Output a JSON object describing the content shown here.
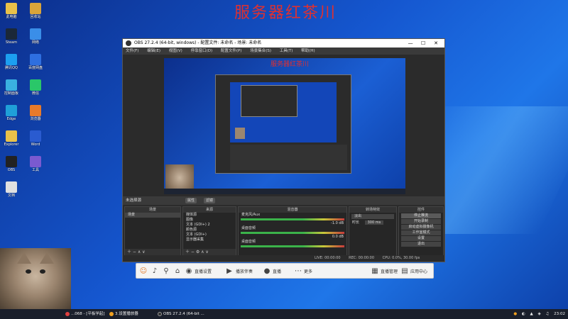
{
  "banner": "服务器红茶川",
  "desktop_icons": [
    {
      "label": "此电脑",
      "color": "#e8c14a"
    },
    {
      "label": "回收站",
      "color": "#d9a43a"
    },
    {
      "label": "Steam",
      "color": "#1b2838"
    },
    {
      "label": "网络",
      "color": "#3a8ee8"
    },
    {
      "label": "腾讯QQ",
      "color": "#1c9ff0"
    },
    {
      "label": "百度网盘",
      "color": "#2e6fe0"
    },
    {
      "label": "控制面板",
      "color": "#3ab0e0"
    },
    {
      "label": "微信",
      "color": "#2ac769"
    },
    {
      "label": "Edge",
      "color": "#1fa0d8"
    },
    {
      "label": "浏览器",
      "color": "#e87a2a"
    },
    {
      "label": "Explorer",
      "color": "#e8c14a"
    },
    {
      "label": "Word",
      "color": "#2a5bd0"
    },
    {
      "label": "OBS",
      "color": "#222222"
    },
    {
      "label": "工具",
      "color": "#7a5ad0"
    },
    {
      "label": "文档",
      "color": "#e0e0e0"
    }
  ],
  "obs": {
    "title": "OBS 27.2.4 (64-bit, windows) - 配置文件: 未命名 - 场景: 未命名",
    "menu": [
      "文件(F)",
      "编辑(E)",
      "视图(V)",
      "停靠窗口(D)",
      "配置文件(P)",
      "场景集合(S)",
      "工具(T)",
      "帮助(H)"
    ],
    "preview_banner": "服务器红茶川",
    "scene_bar": {
      "label": "未选择源",
      "properties": "属性",
      "filters": "滤镜"
    },
    "docks": {
      "scenes": {
        "title": "场景",
        "items": [
          "场景"
        ]
      },
      "sources": {
        "title": "来源",
        "items": [
          "媒体源",
          "图像",
          "文本 (GDI+) 2",
          "颜色源",
          "文本 (GDI+)",
          "显示器采集"
        ]
      },
      "mixer": {
        "title": "混音器",
        "tracks": [
          {
            "name": "麦克风/Aux",
            "db": "-1.0 dB"
          },
          {
            "name": "桌面音频",
            "db": "0.0 dB"
          },
          {
            "name": "桌面音频",
            "db": ""
          }
        ]
      },
      "transitions": {
        "title": "转场特效",
        "type": "淡出",
        "duration_label": "时长",
        "duration": "300 ms"
      },
      "controls": {
        "title": "控件",
        "buttons": [
          "停止推流",
          "开始录制",
          "启动虚拟摄像机",
          "工作室模式",
          "设置",
          "退出"
        ]
      }
    },
    "status": {
      "live": "LIVE: 00:00:00",
      "rec": "REC: 00:00:00",
      "cpu": "CPU: 0.0%, 30.00 fps"
    }
  },
  "toolbar": {
    "items": [
      "美颜",
      "麦克风",
      "扬声器",
      "直播设置",
      "播放伴奏",
      "直播",
      "更多",
      "设置"
    ],
    "right": [
      "直播管理",
      "应用中心"
    ]
  },
  "taskbar": {
    "items": [
      {
        "label": "...068 - [平板学起]",
        "color": "#e04040"
      },
      {
        "label": "3.设置播放器",
        "color": "#f0a020"
      },
      {
        "label": "OBS 27.2.4 (64-bit ...",
        "color": "#333333"
      }
    ],
    "tray": {
      "time": "23:02"
    }
  }
}
